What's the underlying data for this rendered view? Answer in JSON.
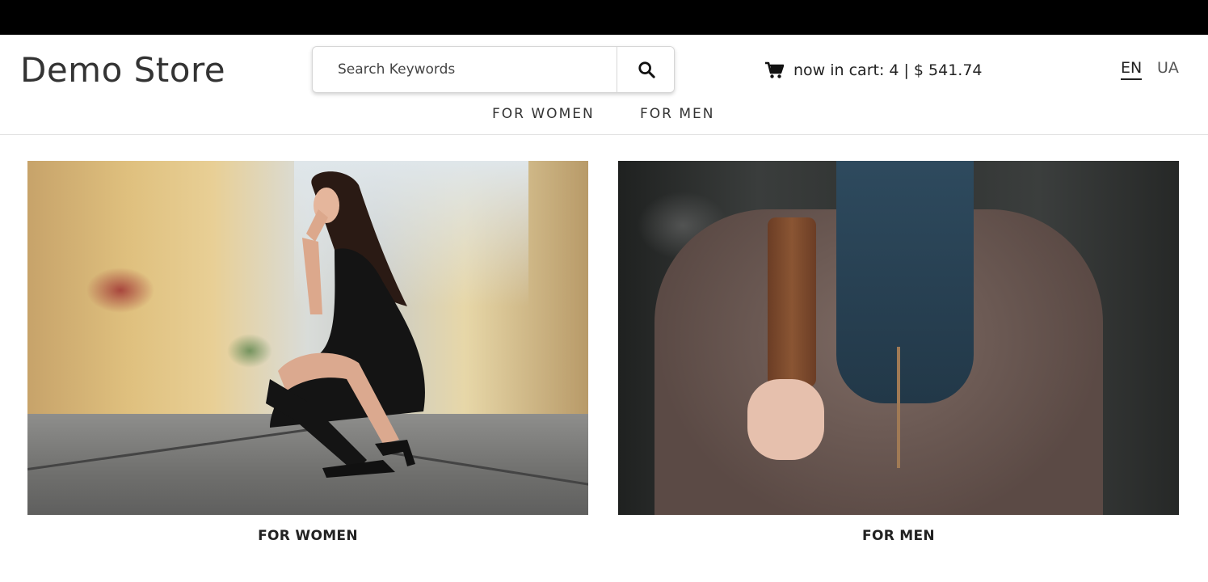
{
  "header": {
    "logo": "Demo Store",
    "search": {
      "placeholder": "Search Keywords",
      "value": ""
    },
    "cart": {
      "label": "now in cart: 4",
      "separator": "|",
      "total": "$ 541.74"
    },
    "languages": {
      "active": "EN",
      "other": "UA"
    },
    "nav": {
      "women": "FOR WOMEN",
      "men": "FOR MEN"
    }
  },
  "categories": [
    {
      "caption": "FOR WOMEN"
    },
    {
      "caption": "FOR MEN"
    }
  ],
  "colors": {
    "topbar": "#000000",
    "text": "#222222",
    "border": "#e2e2e2"
  },
  "icons": {
    "search": "search-icon",
    "cart": "cart-icon"
  }
}
